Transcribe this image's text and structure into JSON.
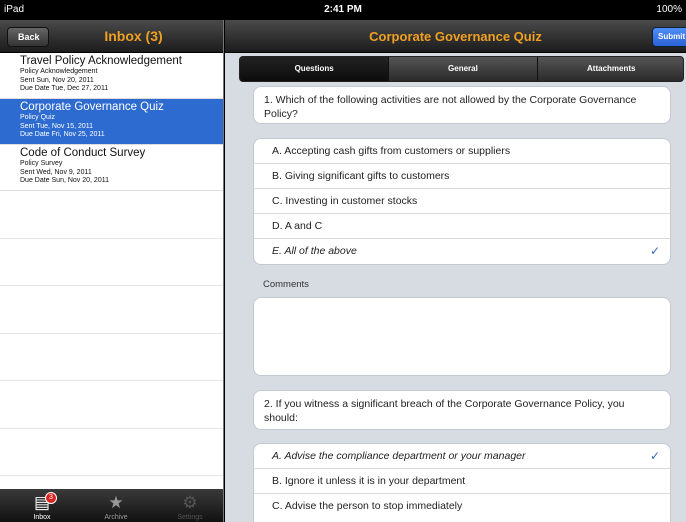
{
  "status": {
    "device": "iPad",
    "time": "2:41 PM",
    "battery": "100%"
  },
  "left": {
    "back_label": "Back",
    "title": "Inbox (3)",
    "items": [
      {
        "title": "Travel Policy Acknowledgement",
        "type": "Policy Acknowledgement",
        "sent": "Sent  Sun, Nov 20, 2011",
        "due": "Due Date  Tue, Dec 27, 2011",
        "selected": false
      },
      {
        "title": "Corporate Governance Quiz",
        "type": "Policy Quiz",
        "sent": "Sent  Tue, Nov 15, 2011",
        "due": "Due Date  Fri, Nov 25, 2011",
        "selected": true
      },
      {
        "title": "Code of Conduct Survey",
        "type": "Policy Survey",
        "sent": "Sent  Wed, Nov 9, 2011",
        "due": "Due Date  Sun, Nov 20, 2011",
        "selected": false
      }
    ],
    "tabs": [
      {
        "label": "Inbox",
        "icon": "inbox-icon",
        "badge": "3"
      },
      {
        "label": "Archive",
        "icon": "archive-icon"
      },
      {
        "label": "Settings",
        "icon": "gear-icon"
      }
    ]
  },
  "right": {
    "title": "Corporate Governance Quiz",
    "submit_label": "Submit",
    "segments": [
      "Questions",
      "General",
      "Attachments"
    ],
    "q1": {
      "text": "1. Which of the following activities are not allowed by the Corporate Governance Policy?",
      "options": [
        "A. Accepting cash gifts from customers or suppliers",
        "B. Giving significant gifts to customers",
        "C. Investing in customer stocks",
        "D. A and C",
        "E. All of the above"
      ],
      "selected_index": 4
    },
    "comments_label": "Comments",
    "q2": {
      "text": "2. If you witness a significant breach of the Corporate Governance Policy, you should:",
      "options": [
        "A. Advise the compliance department or your manager",
        "B. Ignore it unless it is in your department",
        "C. Advise the person to stop immediately"
      ],
      "selected_index": 0
    },
    "check_glyph": "✓"
  },
  "colors": {
    "accent_title": "#f0a020",
    "selection": "#2e6bd0",
    "check": "#3667b6",
    "badge": "#d9231f"
  }
}
